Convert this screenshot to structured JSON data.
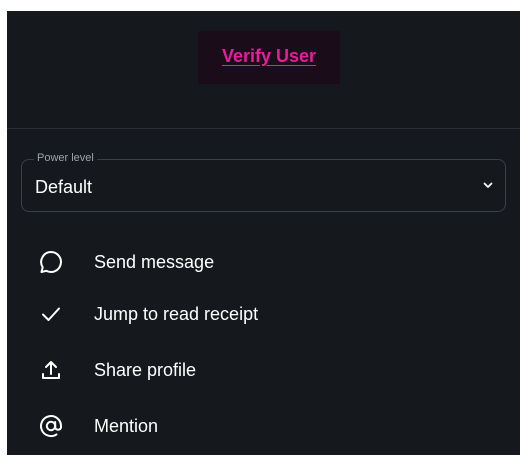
{
  "header": {
    "verify_label": "Verify User"
  },
  "power_level": {
    "legend": "Power level",
    "value": "Default"
  },
  "actions": [
    {
      "label": "Send message",
      "icon": "chat-bubble-icon"
    },
    {
      "label": "Jump to read receipt",
      "icon": "checkmark-icon"
    },
    {
      "label": "Share profile",
      "icon": "share-upload-icon"
    },
    {
      "label": "Mention",
      "icon": "at-sign-icon"
    }
  ],
  "colors": {
    "background": "#15191e",
    "accent": "#e71d9b",
    "text": "#ffffff"
  }
}
